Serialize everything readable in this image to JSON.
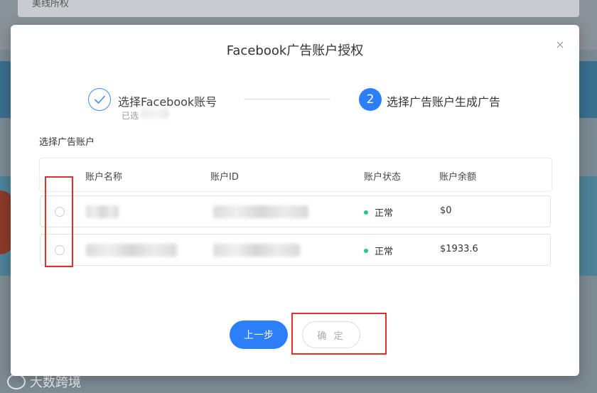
{
  "background": {
    "search_text": "美线所权"
  },
  "watermark": {
    "text": "大数跨境"
  },
  "modal": {
    "title": "Facebook广告账户授权",
    "close_icon": "close-icon"
  },
  "steps": [
    {
      "label": "选择Facebook账号",
      "sub": "已选",
      "state": "done",
      "icon": "check-icon"
    },
    {
      "number": "2",
      "label": "选择广告账户生成广告",
      "state": "active"
    }
  ],
  "section_label": "选择广告账户",
  "table": {
    "columns": [
      "账户名称",
      "账户ID",
      "账户状态",
      "账户余额"
    ],
    "rows": [
      {
        "status": "正常",
        "balance": "$0"
      },
      {
        "status": "正常",
        "balance": "$1933.6"
      }
    ]
  },
  "buttons": {
    "prev": "上一步",
    "confirm": "确 定"
  },
  "colors": {
    "primary": "#2d7ff9",
    "status_ok": "#27c68b",
    "annotation": "#e0302a"
  }
}
